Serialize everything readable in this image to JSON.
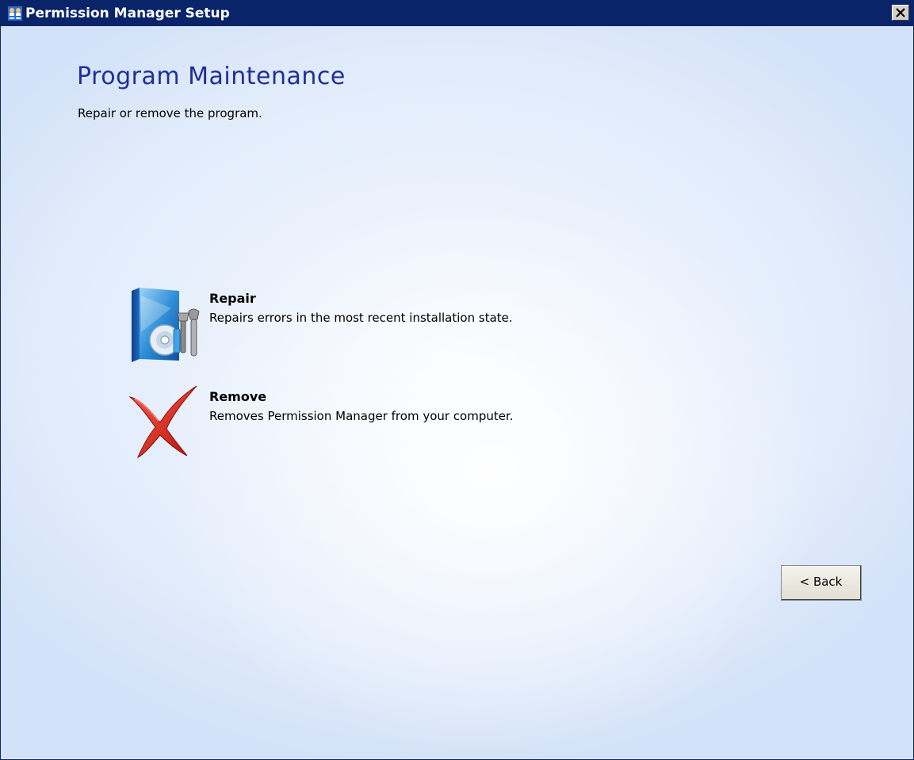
{
  "window": {
    "title": "Permission Manager Setup",
    "titlebar_color": "#0a246a",
    "app_icon": "people-installer-icon",
    "close_icon": "close-x-icon"
  },
  "page": {
    "heading": "Program Maintenance",
    "subheading": "Repair or remove the program.",
    "heading_color": "#1f2f9a"
  },
  "options": {
    "repair": {
      "title": "Repair",
      "description": "Repairs errors in the most recent installation state.",
      "icon": "repair-cd-tools-icon"
    },
    "remove": {
      "title": "Remove",
      "description": "Removes Permission Manager from your computer.",
      "icon": "red-x-remove-icon"
    }
  },
  "buttons": {
    "back_label": "< Back"
  }
}
